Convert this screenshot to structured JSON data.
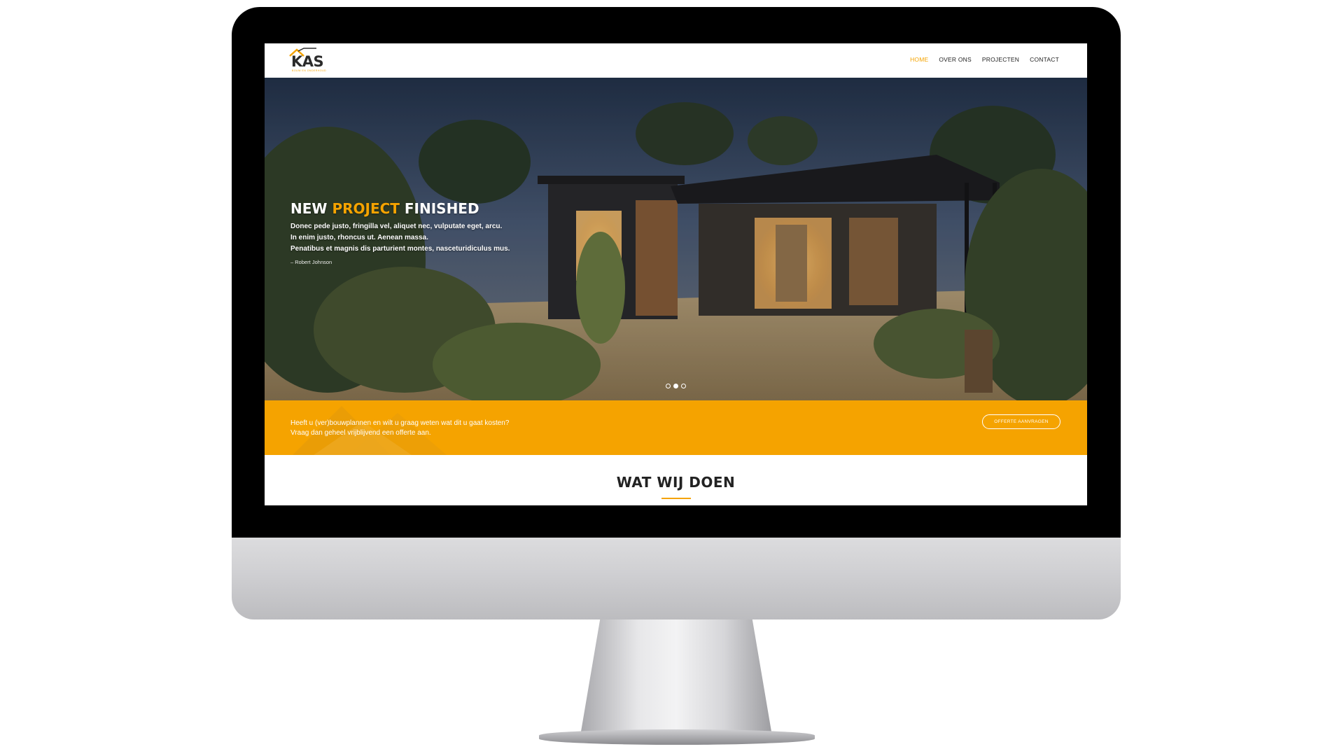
{
  "brand": {
    "logo_text": "KAS",
    "logo_tagline": "BOUW EN ONDERHOUD",
    "accent_color": "#f5a300"
  },
  "nav": {
    "items": [
      {
        "label": "HOME",
        "active": true
      },
      {
        "label": "OVER ONS",
        "active": false
      },
      {
        "label": "PROJECTEN",
        "active": false
      },
      {
        "label": "CONTACT",
        "active": false
      }
    ]
  },
  "hero": {
    "title_part1": "NEW ",
    "title_accent": "PROJECT",
    "title_part2": " FINISHED",
    "lines": [
      "Donec pede justo, fringilla vel, aliquet nec, vulputate eget, arcu.",
      "In enim justo, rhoncus ut. Aenean massa.",
      "Penatibus et magnis dis parturient montes, nasceturidiculus mus."
    ],
    "author": "– Robert Johnson",
    "slides": 3,
    "active_slide": 2
  },
  "cta": {
    "line1": "Heeft u (ver)bouwplannen en wilt u graag weten wat dit u gaat kosten?",
    "line2": "Vraag dan geheel vrijblijvend een offerte aan.",
    "button_label": "OFFERTE AANVRAGEN"
  },
  "section": {
    "title": "WAT WIJ DOEN"
  }
}
